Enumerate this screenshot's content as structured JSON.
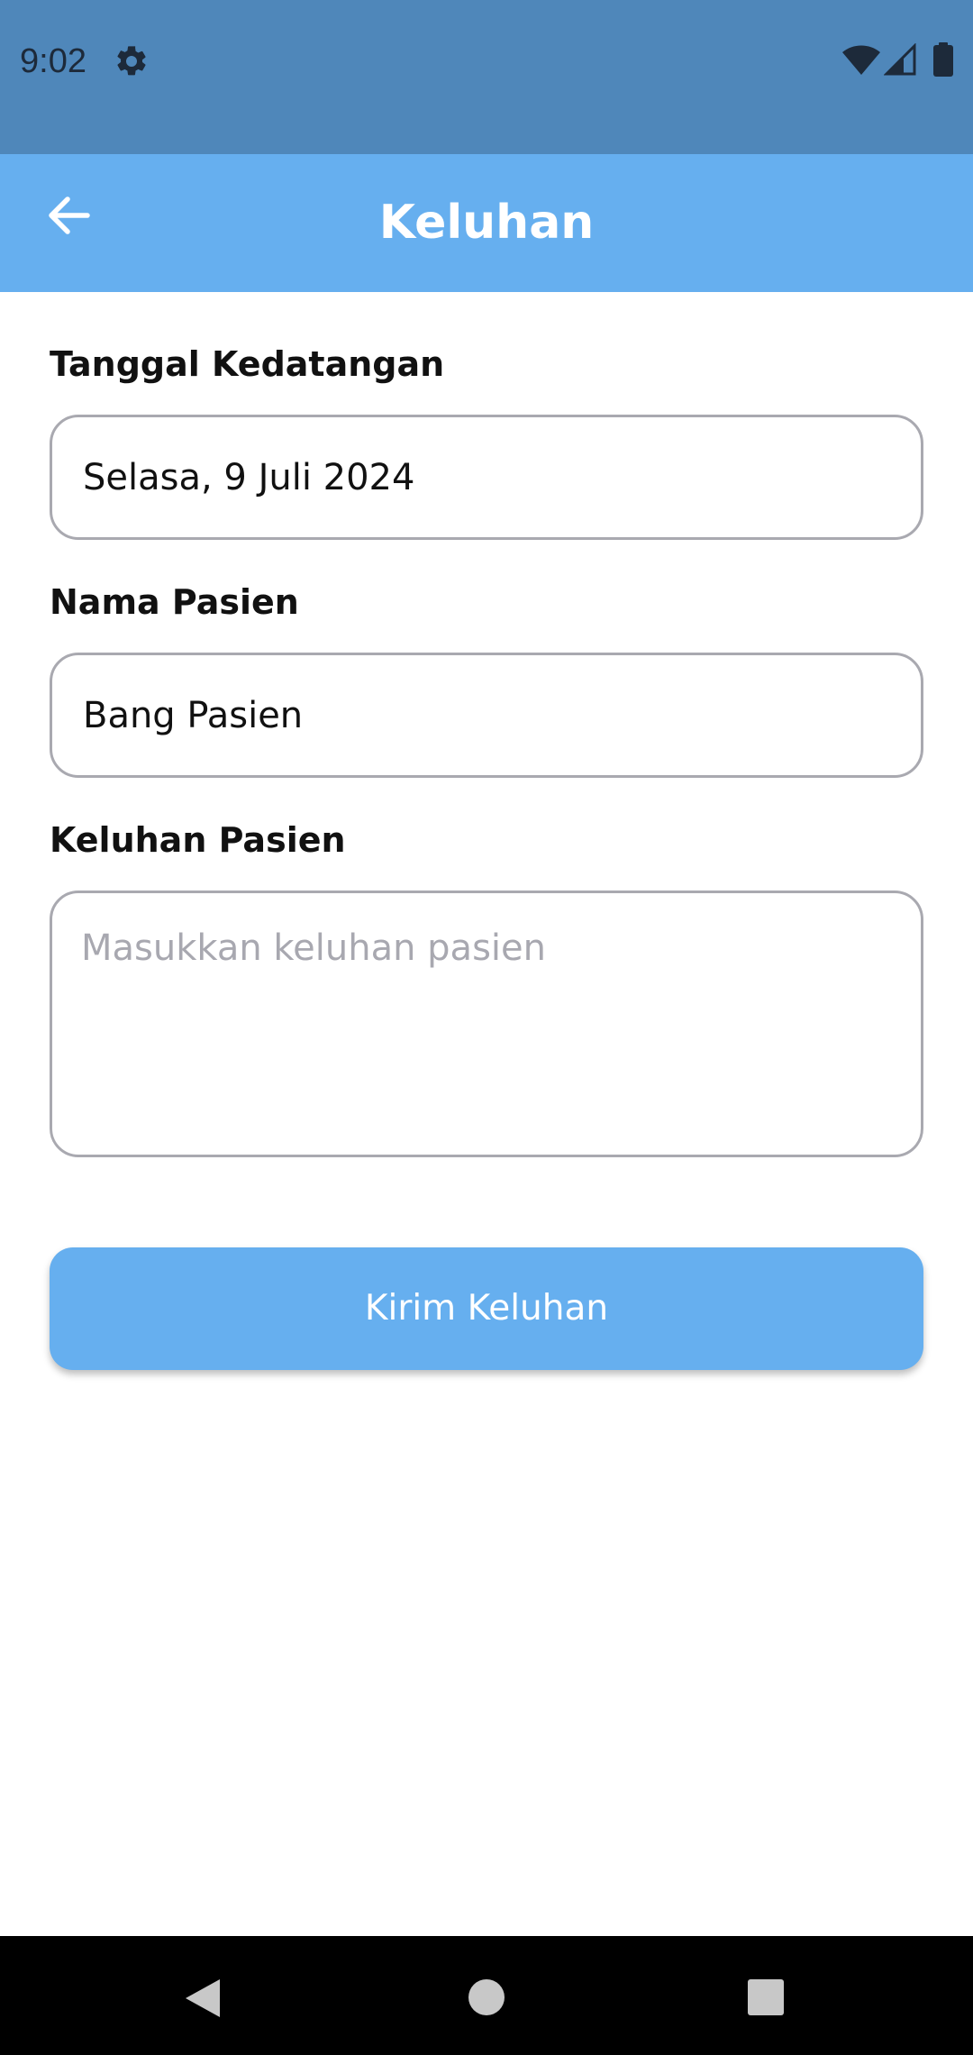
{
  "status_bar": {
    "time": "9:02",
    "icons": [
      "gear-icon",
      "wifi-icon",
      "signal-icon",
      "battery-icon"
    ],
    "background": "#4f87ba"
  },
  "app_bar": {
    "title": "Keluhan",
    "back_icon": "arrow-left-icon",
    "background": "#66afef"
  },
  "form": {
    "arrival_date": {
      "label": "Tanggal Kedatangan",
      "value": "Selasa, 9 Juli 2024"
    },
    "patient_name": {
      "label": "Nama Pasien",
      "value": "Bang Pasien"
    },
    "complaint": {
      "label": "Keluhan Pasien",
      "value": "",
      "placeholder": "Masukkan keluhan pasien"
    },
    "submit_label": "Kirim Keluhan"
  },
  "nav_bar": {
    "icons": [
      "nav-back-icon",
      "nav-home-icon",
      "nav-recents-icon"
    ]
  },
  "colors": {
    "accent": "#66afef",
    "border": "#a9a9b0",
    "placeholder": "#a8a8b0"
  }
}
